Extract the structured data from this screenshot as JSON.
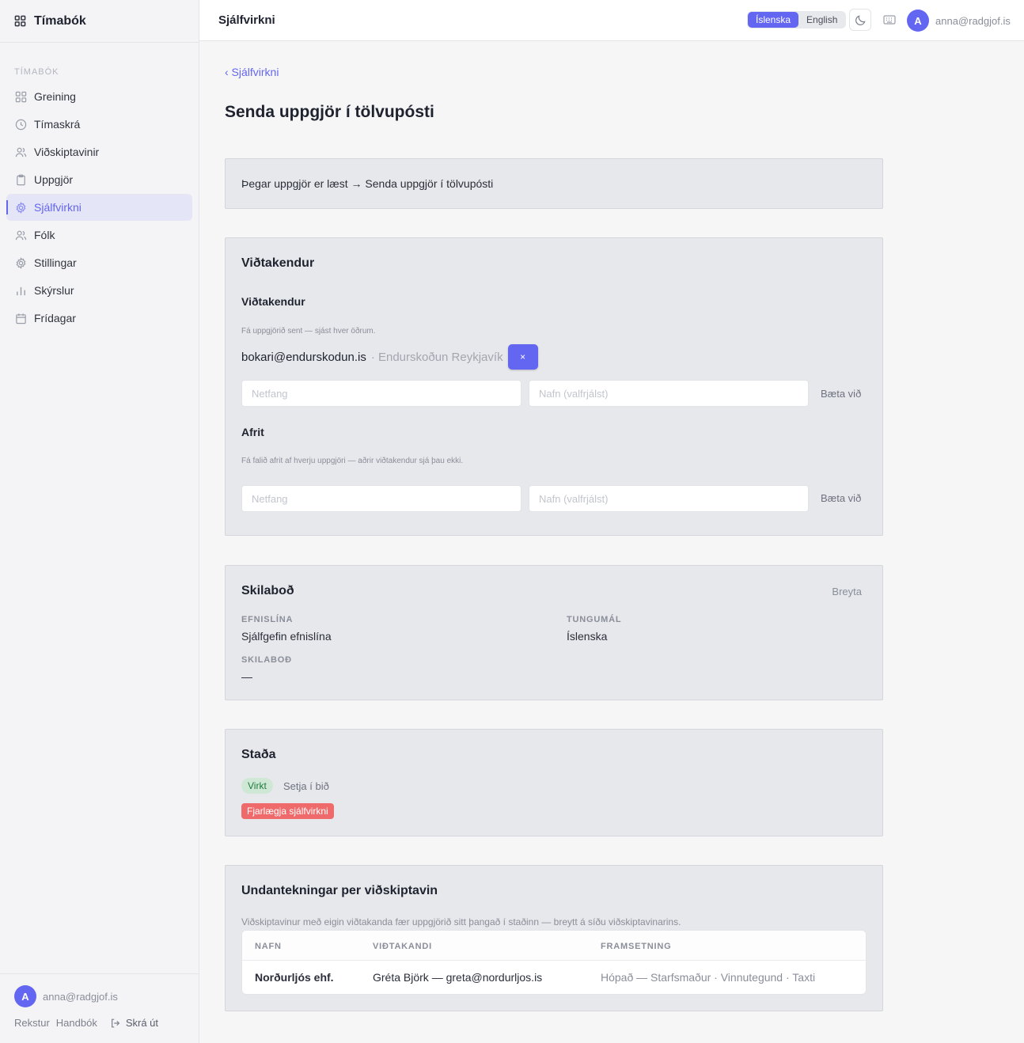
{
  "brand": {
    "name": "Tímabók"
  },
  "sidebar": {
    "heading": "TÍMABÓK",
    "items": [
      {
        "label": "Greining",
        "icon": "grid-icon"
      },
      {
        "label": "Tímaskrá",
        "icon": "clock-icon"
      },
      {
        "label": "Viðskiptavinir",
        "icon": "users-icon"
      },
      {
        "label": "Uppgjör",
        "icon": "clipboard-icon"
      },
      {
        "label": "Sjálfvirkni",
        "icon": "gear-icon",
        "active": true
      },
      {
        "label": "Fólk",
        "icon": "people-icon"
      },
      {
        "label": "Stillingar",
        "icon": "settings-icon"
      },
      {
        "label": "Skýrslur",
        "icon": "bar-chart-icon"
      },
      {
        "label": "Frídagar",
        "icon": "calendar-icon"
      }
    ],
    "footer": {
      "avatar_letter": "A",
      "user_email": "anna@radgjof.is",
      "link_operations": "Rekstur",
      "link_handbook": "Handbók",
      "logout": "Skrá út"
    }
  },
  "topbar": {
    "title": "Sjálfvirkni",
    "lang_is": "Íslenska",
    "lang_en": "English",
    "avatar_letter": "A",
    "user_email": "anna@radgjof.is"
  },
  "page": {
    "back_link": "‹ Sjálfvirkni",
    "title": "Senda uppgjör í tölvupósti",
    "trigger": "Þegar uppgjör er læst → Senda uppgjör í tölvupósti"
  },
  "recipients": {
    "card_title": "Viðtakendur",
    "to_title": "Viðtakendur",
    "to_hint": "Fá uppgjörið sent — sjást hver öðrum.",
    "entry_email": "bokari@endurskodun.is",
    "entry_name": "· Endurskoðun Reykjavík",
    "remove_label": "×",
    "email_placeholder": "Netfang",
    "name_placeholder": "Nafn (valfrjálst)",
    "add_label": "Bæta við",
    "cc_title": "Afrit",
    "cc_hint": "Fá falið afrit af hverju uppgjöri — aðrir viðtakendur sjá þau ekki.",
    "cc_email_placeholder": "Netfang",
    "cc_name_placeholder": "Nafn (valfrjálst)",
    "cc_add_label": "Bæta við"
  },
  "message": {
    "card_title": "Skilaboð",
    "edit_label": "Breyta",
    "subject_label": "EFNISLÍNA",
    "subject_value": "Sjálfgefin efnislína",
    "language_label": "TUNGUMÁL",
    "language_value": "Íslenska",
    "body_label": "SKILABOÐ",
    "body_value": "—"
  },
  "status": {
    "card_title": "Staða",
    "active_badge": "Virkt",
    "pause_label": "Setja í bið",
    "delete_label": "Fjarlægja sjálfvirkni"
  },
  "exceptions": {
    "card_title": "Undantekningar per viðskiptavin",
    "hint": "Viðskiptavinur með eigin viðtakanda fær uppgjörið sitt þangað í staðinn — breytt á síðu viðskiptavinarins.",
    "columns": [
      "NAFN",
      "VIÐTAKANDI",
      "FRAMSETNING"
    ],
    "rows": [
      [
        "Norðurljós ehf.",
        "Gréta Björk — greta@nordurljos.is",
        "Hópað — Starfsmaður · Vinnutegund · Taxti"
      ]
    ]
  },
  "colors": {
    "accent": "#6366f1",
    "success_bg": "#cfe8d6",
    "success_text": "#1f7a3c",
    "danger": "#ef6b6b"
  }
}
